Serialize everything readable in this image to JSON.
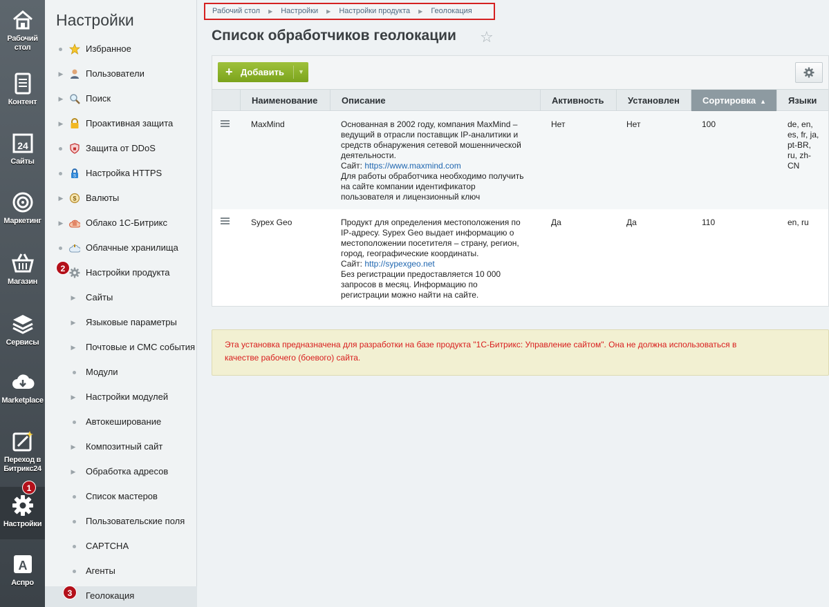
{
  "leftmenu": {
    "items": [
      {
        "label": "Рабочий стол",
        "icon": "home-icon"
      },
      {
        "label": "Контент",
        "icon": "document-icon"
      },
      {
        "label": "Сайты",
        "icon": "calendar-24-icon"
      },
      {
        "label": "Маркетинг",
        "icon": "target-icon"
      },
      {
        "label": "Магазин",
        "icon": "basket-icon"
      },
      {
        "label": "Сервисы",
        "icon": "layers-icon"
      },
      {
        "label": "Marketplace",
        "icon": "cloud-download-icon"
      },
      {
        "label": "Переход в Битрикс24",
        "icon": "magic-wand-icon"
      },
      {
        "label": "Настройки",
        "icon": "gear-icon"
      },
      {
        "label": "Аспро",
        "icon": "letter-a-icon"
      }
    ],
    "badge": "1"
  },
  "sidebar": {
    "title": "Настройки",
    "items": [
      {
        "label": "Избранное",
        "icon": "star-icon"
      },
      {
        "label": "Пользователи",
        "icon": "user-icon"
      },
      {
        "label": "Поиск",
        "icon": "search-icon"
      },
      {
        "label": "Проактивная защита",
        "icon": "lock-icon"
      },
      {
        "label": "Защита от DDoS",
        "icon": "shield-icon"
      },
      {
        "label": "Настройка HTTPS",
        "icon": "https-lock-icon"
      },
      {
        "label": "Валюты",
        "icon": "currency-icon"
      },
      {
        "label": "Облако 1С-Битрикс",
        "icon": "cloud-hand-icon"
      },
      {
        "label": "Облачные хранилища",
        "icon": "cloud-storage-icon"
      },
      {
        "label": "Настройки продукта",
        "icon": "gear-icon"
      },
      {
        "label": "Сайты"
      },
      {
        "label": "Языковые параметры"
      },
      {
        "label": "Почтовые и СМС события"
      },
      {
        "label": "Модули"
      },
      {
        "label": "Настройки модулей"
      },
      {
        "label": "Автокеширование"
      },
      {
        "label": "Композитный сайт"
      },
      {
        "label": "Обработка адресов"
      },
      {
        "label": "Список мастеров"
      },
      {
        "label": "Пользовательские поля"
      },
      {
        "label": "CAPTCHA"
      },
      {
        "label": "Агенты"
      },
      {
        "label": "Геолокация"
      }
    ],
    "badge_product": "2",
    "badge_geo": "3"
  },
  "breadcrumb": [
    "Рабочий стол",
    "Настройки",
    "Настройки продукта",
    "Геолокация"
  ],
  "page": {
    "title": "Список обработчиков геолокации"
  },
  "toolbar": {
    "add_label": "Добавить"
  },
  "table": {
    "columns": [
      "Наименование",
      "Описание",
      "Активность",
      "Установлен",
      "Сортировка",
      "Языки"
    ],
    "rows": [
      {
        "name": "MaxMind",
        "desc_lines": [
          "Основанная в 2002 году, компания MaxMind –",
          "ведущий в отрасли поставщик IP-аналитики и",
          "средств обнаружения сетевой мошеннической",
          "деятельности."
        ],
        "site_prefix": "Сайт: ",
        "site": "https://www.maxmind.com",
        "desc_tail": [
          "Для работы обработчика необходимо получить",
          "на сайте компании идентификатор",
          "пользователя и лицензионный ключ"
        ],
        "active": "Нет",
        "installed": "Нет",
        "sort": "100",
        "langs": [
          "de, en,",
          "es, fr, ja,",
          "pt-BR,",
          "ru, zh-",
          "CN"
        ]
      },
      {
        "name": "Sypex Geo",
        "desc_lines": [
          "Продукт для определения местоположения по",
          "IP-адресу. Sypex Geo выдает информацию о",
          "местоположении посетителя – страну, регион,",
          "город, географические координаты."
        ],
        "site_prefix": "Сайт: ",
        "site": "http://sypexgeo.net",
        "desc_tail": [
          "Без регистрации предоставляется 10 000",
          "запросов в месяц. Информацию по",
          "регистрации можно найти на сайте."
        ],
        "active": "Да",
        "installed": "Да",
        "sort": "110",
        "langs": [
          "en, ru"
        ]
      }
    ]
  },
  "warning": {
    "line1": "Эта установка предназначена для разработки на базе продукта \"1С-Битрикс: Управление сайтом\". Она не должна использоваться в",
    "line2": "качестве рабочего (боевого) сайта."
  }
}
